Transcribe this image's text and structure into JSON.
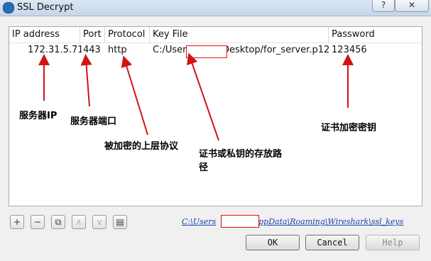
{
  "window": {
    "title": "SSL Decrypt",
    "help_glyph": "?",
    "close_glyph": "✕"
  },
  "table": {
    "columns": [
      "IP address",
      "Port",
      "Protocol",
      "Key File",
      "Password"
    ],
    "rows": [
      {
        "ip": "172.31.5.71",
        "port": "443",
        "protocol": "http",
        "key_file_prefix": "C:/Users",
        "key_file_suffix": "Desktop/for_server.p12",
        "password": "123456"
      }
    ]
  },
  "annotations": {
    "server_ip": "服务器IP",
    "server_port": "服务器端口",
    "protocol": "被加密的上层协议",
    "key_path_line1": "证书或私钥的存放路",
    "key_path_line2": "径",
    "password": "证书加密密钥"
  },
  "toolbar": {
    "add": "+",
    "remove": "−",
    "copy": "⧉",
    "up": "∧",
    "down": "∨",
    "clear": "▤"
  },
  "path_link": {
    "prefix": "C:\\Users",
    "suffix": "AppData\\Roaming\\Wireshark\\ssl_keys"
  },
  "buttons": {
    "ok": "OK",
    "cancel": "Cancel",
    "help": "Help"
  },
  "colors": {
    "annotation_arrow": "#d11414",
    "redaction_box": "#d11414",
    "link": "#1a3fb0"
  }
}
